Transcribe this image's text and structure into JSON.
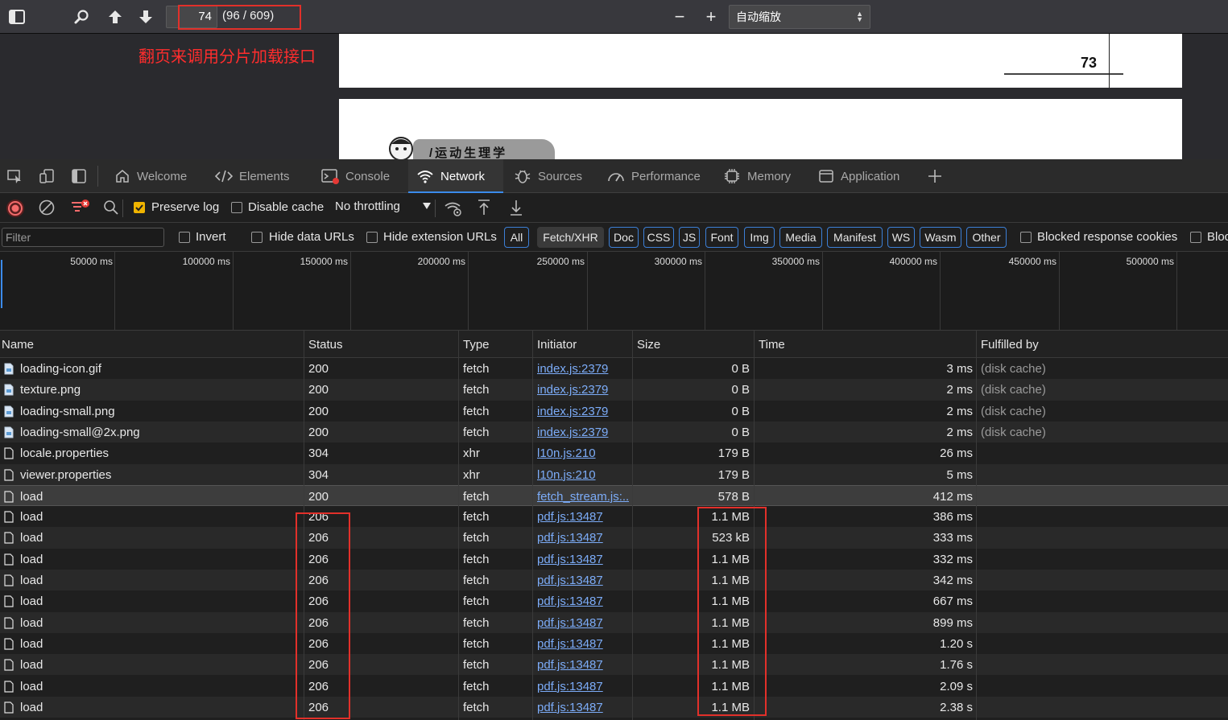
{
  "pdf_toolbar": {
    "page_value": "74",
    "page_count": "(96 / 609)",
    "zoom_value": "自动缩放",
    "zoom_out": "−",
    "zoom_in": "+"
  },
  "annotation": "翻页来调用分片加载接口",
  "pdf_page": {
    "page_number": "73",
    "page_header": "/运动生理学"
  },
  "devtools_tabs": [
    {
      "label": "Welcome"
    },
    {
      "label": "Elements"
    },
    {
      "label": "Console"
    },
    {
      "label": "Network"
    },
    {
      "label": "Sources"
    },
    {
      "label": "Performance"
    },
    {
      "label": "Memory"
    },
    {
      "label": "Application"
    }
  ],
  "network_toolbar": {
    "preserve_log": "Preserve log",
    "disable_cache": "Disable cache",
    "throttling": "No throttling"
  },
  "filter_bar": {
    "placeholder": "Filter",
    "invert": "Invert",
    "hide_data_urls": "Hide data URLs",
    "hide_extension_urls": "Hide extension URLs",
    "chips": [
      "All",
      "Fetch/XHR",
      "Doc",
      "CSS",
      "JS",
      "Font",
      "Img",
      "Media",
      "Manifest",
      "WS",
      "Wasm",
      "Other"
    ],
    "blocked_cookies": "Blocked response cookies",
    "blocked_requests": "Bloc"
  },
  "overview_ticks": [
    "50000 ms",
    "100000 ms",
    "150000 ms",
    "200000 ms",
    "250000 ms",
    "300000 ms",
    "350000 ms",
    "400000 ms",
    "450000 ms",
    "500000 ms"
  ],
  "table": {
    "columns": [
      "Name",
      "Status",
      "Type",
      "Initiator",
      "Size",
      "Time",
      "Fulfilled by"
    ],
    "rows": [
      {
        "name": "loading-icon.gif",
        "status": "200",
        "type": "fetch",
        "initiator": "index.js:2379",
        "size": "0 B",
        "time": "3 ms",
        "fulfilled": "(disk cache)",
        "icon": "image-file-icon"
      },
      {
        "name": "texture.png",
        "status": "200",
        "type": "fetch",
        "initiator": "index.js:2379",
        "size": "0 B",
        "time": "2 ms",
        "fulfilled": "(disk cache)",
        "icon": "image-file-icon"
      },
      {
        "name": "loading-small.png",
        "status": "200",
        "type": "fetch",
        "initiator": "index.js:2379",
        "size": "0 B",
        "time": "2 ms",
        "fulfilled": "(disk cache)",
        "icon": "image-file-icon"
      },
      {
        "name": "loading-small@2x.png",
        "status": "200",
        "type": "fetch",
        "initiator": "index.js:2379",
        "size": "0 B",
        "time": "2 ms",
        "fulfilled": "(disk cache)",
        "icon": "image-file-icon"
      },
      {
        "name": "locale.properties",
        "status": "304",
        "type": "xhr",
        "initiator": "l10n.js:210",
        "size": "179 B",
        "time": "26 ms",
        "fulfilled": "",
        "icon": "document-file-icon"
      },
      {
        "name": "viewer.properties",
        "status": "304",
        "type": "xhr",
        "initiator": "l10n.js:210",
        "size": "179 B",
        "time": "5 ms",
        "fulfilled": "",
        "icon": "document-file-icon"
      },
      {
        "name": "load",
        "status": "200",
        "type": "fetch",
        "initiator": "fetch_stream.js:...",
        "size": "578 B",
        "time": "412 ms",
        "fulfilled": "",
        "icon": "document-file-icon"
      },
      {
        "name": "load",
        "status": "206",
        "type": "fetch",
        "initiator": "pdf.js:13487",
        "size": "1.1 MB",
        "time": "386 ms",
        "fulfilled": "",
        "icon": "document-file-icon"
      },
      {
        "name": "load",
        "status": "206",
        "type": "fetch",
        "initiator": "pdf.js:13487",
        "size": "523 kB",
        "time": "333 ms",
        "fulfilled": "",
        "icon": "document-file-icon"
      },
      {
        "name": "load",
        "status": "206",
        "type": "fetch",
        "initiator": "pdf.js:13487",
        "size": "1.1 MB",
        "time": "332 ms",
        "fulfilled": "",
        "icon": "document-file-icon"
      },
      {
        "name": "load",
        "status": "206",
        "type": "fetch",
        "initiator": "pdf.js:13487",
        "size": "1.1 MB",
        "time": "342 ms",
        "fulfilled": "",
        "icon": "document-file-icon"
      },
      {
        "name": "load",
        "status": "206",
        "type": "fetch",
        "initiator": "pdf.js:13487",
        "size": "1.1 MB",
        "time": "667 ms",
        "fulfilled": "",
        "icon": "document-file-icon"
      },
      {
        "name": "load",
        "status": "206",
        "type": "fetch",
        "initiator": "pdf.js:13487",
        "size": "1.1 MB",
        "time": "899 ms",
        "fulfilled": "",
        "icon": "document-file-icon"
      },
      {
        "name": "load",
        "status": "206",
        "type": "fetch",
        "initiator": "pdf.js:13487",
        "size": "1.1 MB",
        "time": "1.20 s",
        "fulfilled": "",
        "icon": "document-file-icon"
      },
      {
        "name": "load",
        "status": "206",
        "type": "fetch",
        "initiator": "pdf.js:13487",
        "size": "1.1 MB",
        "time": "1.76 s",
        "fulfilled": "",
        "icon": "document-file-icon"
      },
      {
        "name": "load",
        "status": "206",
        "type": "fetch",
        "initiator": "pdf.js:13487",
        "size": "1.1 MB",
        "time": "2.09 s",
        "fulfilled": "",
        "icon": "document-file-icon"
      },
      {
        "name": "load",
        "status": "206",
        "type": "fetch",
        "initiator": "pdf.js:13487",
        "size": "1.1 MB",
        "time": "2.38 s",
        "fulfilled": "",
        "icon": "document-file-icon"
      }
    ]
  },
  "colors": {
    "accent": "#3b8beb",
    "annotation_red": "#e2302a",
    "checkbox_checked": "#f0b400",
    "link": "#7cacf8"
  }
}
